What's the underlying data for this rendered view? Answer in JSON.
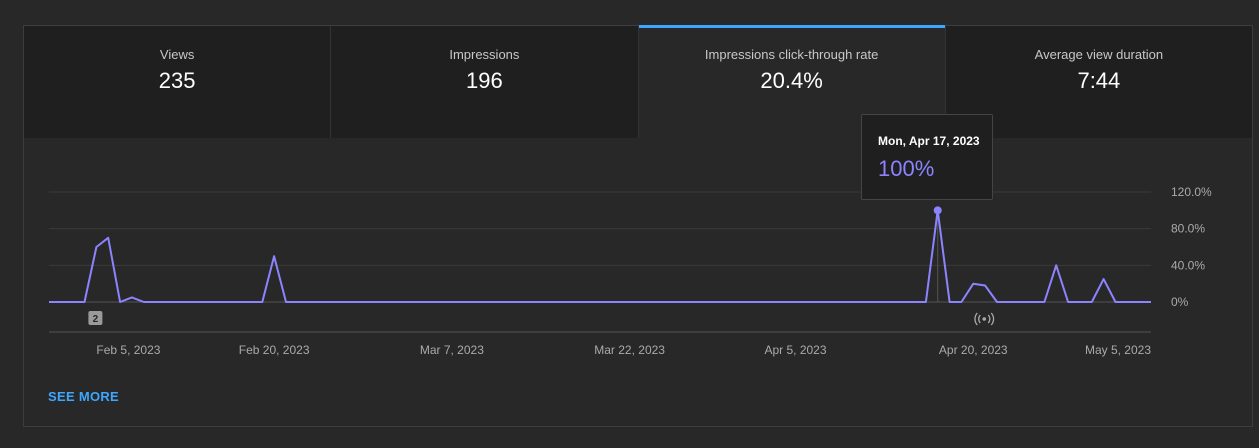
{
  "metrics": [
    {
      "label": "Views",
      "value": "235"
    },
    {
      "label": "Impressions",
      "value": "196"
    },
    {
      "label": "Impressions click-through rate",
      "value": "20.4%"
    },
    {
      "label": "Average view duration",
      "value": "7:44"
    }
  ],
  "active_tab": 2,
  "tooltip": {
    "date": "Mon, Apr 17, 2023",
    "value": "100%"
  },
  "see_more_label": "SEE MORE",
  "marker_badge": "2",
  "icons": {
    "marker": "broadcast-icon"
  },
  "colors": {
    "line": "#8c84ff",
    "accent": "#3ea6ff",
    "background": "#282828",
    "tab_bg": "#1f1f1f"
  },
  "chart_data": {
    "type": "line",
    "title": "",
    "xlabel": "",
    "ylabel": "",
    "ylim": [
      0,
      120
    ],
    "x_start": "2023-02-01",
    "x_end": "2023-05-05",
    "yticks": [
      "0%",
      "40.0%",
      "80.0%",
      "120.0%"
    ],
    "ytick_values": [
      0,
      40,
      80,
      120
    ],
    "xticks": [
      "Feb 5, 2023",
      "Feb 20, 2023",
      "Mar 7, 2023",
      "Mar 22, 2023",
      "Apr 5, 2023",
      "Apr 20, 2023",
      "May 5, 2023"
    ],
    "xtick_dates": [
      "2023-02-05",
      "2023-02-20",
      "2023-03-07",
      "2023-03-22",
      "2023-04-05",
      "2023-04-20",
      "2023-05-05"
    ],
    "grid": true,
    "series": [
      {
        "name": "",
        "points": [
          [
            "2023-02-01",
            0
          ],
          [
            "2023-02-04",
            0
          ],
          [
            "2023-02-05",
            60
          ],
          [
            "2023-02-06",
            70
          ],
          [
            "2023-02-07",
            0
          ],
          [
            "2023-02-08",
            5
          ],
          [
            "2023-02-09",
            0
          ],
          [
            "2023-02-19",
            0
          ],
          [
            "2023-02-20",
            50
          ],
          [
            "2023-02-21",
            0
          ],
          [
            "2023-04-16",
            0
          ],
          [
            "2023-04-17",
            100
          ],
          [
            "2023-04-18",
            0
          ],
          [
            "2023-04-19",
            0
          ],
          [
            "2023-04-20",
            20
          ],
          [
            "2023-04-21",
            18
          ],
          [
            "2023-04-22",
            0
          ],
          [
            "2023-04-26",
            0
          ],
          [
            "2023-04-27",
            40
          ],
          [
            "2023-04-28",
            0
          ],
          [
            "2023-04-30",
            0
          ],
          [
            "2023-05-01",
            25
          ],
          [
            "2023-05-02",
            0
          ],
          [
            "2023-05-05",
            0
          ]
        ]
      }
    ],
    "highlight": {
      "date": "2023-04-17",
      "value": 100
    }
  }
}
